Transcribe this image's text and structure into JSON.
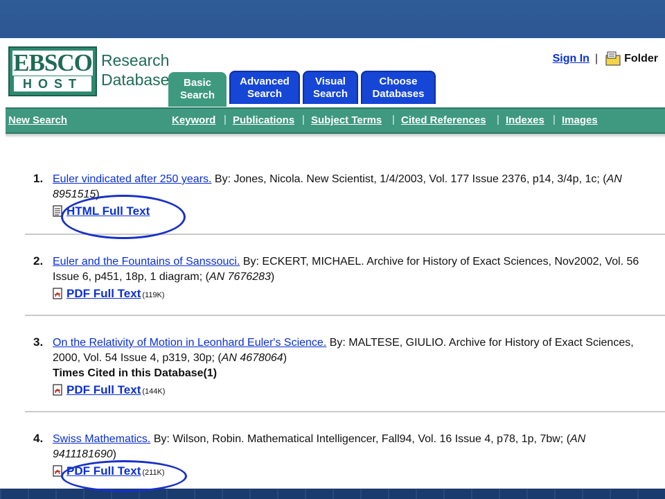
{
  "logo": {
    "top": "EBSCO",
    "bottom": "HOST",
    "line1": "Research",
    "line2": "Databases"
  },
  "tabs": [
    {
      "label": "Basic Search",
      "active": true
    },
    {
      "label": "Advanced Search",
      "active": false
    },
    {
      "label": "Visual Search",
      "active": false
    },
    {
      "label": "Choose Databases",
      "active": false
    }
  ],
  "header": {
    "sign_in": "Sign In",
    "separator": "|",
    "folder": "Folder"
  },
  "nav": {
    "new_search": "New Search",
    "links": [
      "Keyword",
      "Publications",
      "Subject Terms",
      "Cited References",
      "Indexes",
      "Images"
    ],
    "separator": "|"
  },
  "results": [
    {
      "number": "1.",
      "title": "Euler vindicated after 250 years.",
      "citation": " By: Jones, Nicola. New Scientist, 1/4/2003, Vol. 177 Issue 2376, p14, 3/4p, 1c; (",
      "an_label": "AN 8951515",
      "citation_end": ")",
      "times_cited": "",
      "fulltext": {
        "label": "HTML Full Text",
        "size": "",
        "icon": "html-document-icon"
      }
    },
    {
      "number": "2.",
      "title": "Euler and the Fountains of Sanssouci.",
      "citation": " By: ECKERT, MICHAEL. Archive for History of Exact Sciences, Nov2002, Vol. 56 Issue 6, p451, 18p, 1 diagram; (",
      "an_label": "AN 7676283",
      "citation_end": ")",
      "times_cited": "",
      "fulltext": {
        "label": "PDF Full Text",
        "size": "(119K)",
        "icon": "pdf-icon"
      }
    },
    {
      "number": "3.",
      "title": "On the Relativity of Motion in Leonhard Euler's Science.",
      "citation": " By: MALTESE, GIULIO. Archive for History of Exact Sciences, 2000, Vol. 54 Issue 4, p319, 30p; (",
      "an_label": "AN 4678064",
      "citation_end": ")",
      "times_cited": "Times Cited in this Database(1)",
      "fulltext": {
        "label": "PDF Full Text",
        "size": "(144K)",
        "icon": "pdf-icon"
      }
    },
    {
      "number": "4.",
      "title": "Swiss Mathematics.",
      "citation": " By: Wilson, Robin. Mathematical Intelligencer, Fall94, Vol. 16 Issue 4, p78, 1p, 7bw; (",
      "an_label": "AN 9411181690",
      "citation_end": ")",
      "times_cited": "",
      "fulltext": {
        "label": "PDF Full Text",
        "size": "(211K)",
        "icon": "pdf-icon"
      }
    }
  ],
  "colors": {
    "link": "#0a2fd6",
    "brand_green": "#3f9880",
    "tab_blue": "#1546d6",
    "annotation_circle": "#1830c8"
  }
}
